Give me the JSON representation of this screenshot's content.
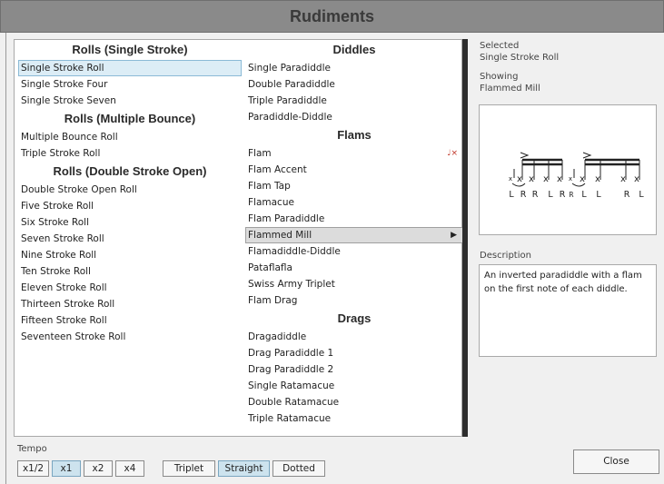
{
  "title": "Rudiments",
  "left_column": [
    {
      "type": "header",
      "text": "Rolls (Single Stroke)"
    },
    {
      "type": "item",
      "text": "Single Stroke Roll",
      "state": "selected"
    },
    {
      "type": "item",
      "text": "Single Stroke Four"
    },
    {
      "type": "item",
      "text": "Single Stroke Seven"
    },
    {
      "type": "header",
      "text": "Rolls (Multiple Bounce)"
    },
    {
      "type": "item",
      "text": "Multiple Bounce Roll"
    },
    {
      "type": "item",
      "text": "Triple Stroke Roll"
    },
    {
      "type": "header",
      "text": "Rolls (Double Stroke Open)"
    },
    {
      "type": "item",
      "text": "Double Stroke Open Roll"
    },
    {
      "type": "item",
      "text": "Five Stroke Roll"
    },
    {
      "type": "item",
      "text": "Six Stroke Roll"
    },
    {
      "type": "item",
      "text": "Seven Stroke Roll"
    },
    {
      "type": "item",
      "text": "Nine Stroke Roll"
    },
    {
      "type": "item",
      "text": "Ten Stroke Roll"
    },
    {
      "type": "item",
      "text": "Eleven Stroke Roll"
    },
    {
      "type": "item",
      "text": "Thirteen Stroke Roll"
    },
    {
      "type": "item",
      "text": "Fifteen Stroke Roll"
    },
    {
      "type": "item",
      "text": "Seventeen Stroke Roll"
    }
  ],
  "middle_column": [
    {
      "type": "header",
      "text": "Diddles"
    },
    {
      "type": "item",
      "text": "Single Paradiddle"
    },
    {
      "type": "item",
      "text": "Double Paradiddle"
    },
    {
      "type": "item",
      "text": "Triple Paradiddle"
    },
    {
      "type": "item",
      "text": "Paradiddle-Diddle"
    },
    {
      "type": "header",
      "text": "Flams"
    },
    {
      "type": "item",
      "text": "Flam",
      "icon": "note-remove-icon",
      "icon_glyph": "♩×"
    },
    {
      "type": "item",
      "text": "Flam Accent"
    },
    {
      "type": "item",
      "text": "Flam Tap"
    },
    {
      "type": "item",
      "text": "Flamacue"
    },
    {
      "type": "item",
      "text": "Flam Paradiddle"
    },
    {
      "type": "item",
      "text": "Flammed Mill",
      "state": "showing",
      "icon": "play-icon",
      "icon_glyph": "▶"
    },
    {
      "type": "item",
      "text": "Flamadiddle-Diddle"
    },
    {
      "type": "item",
      "text": "Pataflafla"
    },
    {
      "type": "item",
      "text": "Swiss Army Triplet"
    },
    {
      "type": "item",
      "text": "Flam Drag"
    },
    {
      "type": "header",
      "text": "Drags"
    },
    {
      "type": "item",
      "text": "Dragadiddle"
    },
    {
      "type": "item",
      "text": "Drag Paradiddle 1"
    },
    {
      "type": "item",
      "text": "Drag Paradiddle 2"
    },
    {
      "type": "item",
      "text": "Single Ratamacue"
    },
    {
      "type": "item",
      "text": "Double Ratamacue"
    },
    {
      "type": "item",
      "text": "Triple Ratamacue"
    }
  ],
  "info": {
    "selected_label": "Selected",
    "selected_value": "Single Stroke Roll",
    "showing_label": "Showing",
    "showing_value": "Flammed Mill",
    "sticking": [
      "L",
      "R",
      "R",
      "L",
      "R",
      "R",
      "L",
      "L",
      "R",
      "L"
    ],
    "description_label": "Description",
    "description_text": "An inverted paradiddle with a flam on the first note of each diddle."
  },
  "tempo": {
    "label": "Tempo",
    "speeds": [
      {
        "label": "x1/2",
        "active": false
      },
      {
        "label": "x1",
        "active": true
      },
      {
        "label": "x2",
        "active": false
      },
      {
        "label": "x4",
        "active": false
      }
    ],
    "feels": [
      {
        "label": "Triplet",
        "active": false
      },
      {
        "label": "Straight",
        "active": true
      },
      {
        "label": "Dotted",
        "active": false
      }
    ]
  },
  "close_label": "Close",
  "colors": {
    "remove_icon": "#c0392b",
    "selected_bg": "#dcedf6",
    "active_button": "#cde3ee"
  }
}
